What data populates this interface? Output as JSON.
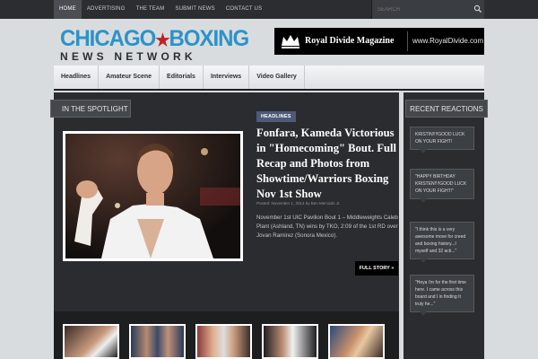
{
  "topnav": {
    "items": [
      {
        "label": "HOME",
        "active": true
      },
      {
        "label": "ADVERTISING",
        "active": false
      },
      {
        "label": "THE TEAM",
        "active": false
      },
      {
        "label": "SUBMIT NEWS",
        "active": false
      },
      {
        "label": "CONTACT US",
        "active": false
      }
    ],
    "search_placeholder": "SEARCH"
  },
  "logo": {
    "line1_left": "CHICAGO",
    "star": "★",
    "line1_right": "BOXING",
    "line2": "NEWS NETWORK"
  },
  "ad": {
    "name": "Royal Divide Magazine",
    "url": "www.RoyalDivide.com"
  },
  "mainnav": {
    "items": [
      "Headlines",
      "Amateur Scene",
      "Editorials",
      "Interviews",
      "Video Gallery"
    ]
  },
  "spotlight": {
    "ribbon": "IN THE SPOTLIGHT",
    "badge": "HEADLINES",
    "headline": "Fonfara, Kameda Victorious in \"Homecoming\" Bout. Full Recap and Photos from Showtime/Warriors Boxing Nov 1st Show",
    "meta": "Posted: November 1, 2014  by  Ben Mercado Jr.",
    "excerpt": "November 1st UIC Pavilion Bout 1 – Middleweights Caleb Plant (Ashland, TN) wins by TKO, 2:09 of the 1st RD over Jovan Ramirez (Sonora Mexico).",
    "full_story": "FULL STORY »"
  },
  "sidebar": {
    "ribbon": "RECENT REACTIONS",
    "reactions": [
      "KRISTIN!!!!GOOD LUCK ON YOUR FIGHT!",
      "\"HAPPY BIRTHDAY KRISTEN!!!!GOOD LUCK ON YOUR FIGHT!\"",
      "\"I think this is a very awesome move for creed and boxing history...I myself and 32 acti...\"",
      "\"Heya i'm for the first time here. I came across this board and I in finding It truly he...\""
    ]
  },
  "colors": {
    "accent_blue": "#2c93c8",
    "accent_red": "#c0232a",
    "dark_panel": "#2a2c2f",
    "badge": "#4d5a79"
  }
}
